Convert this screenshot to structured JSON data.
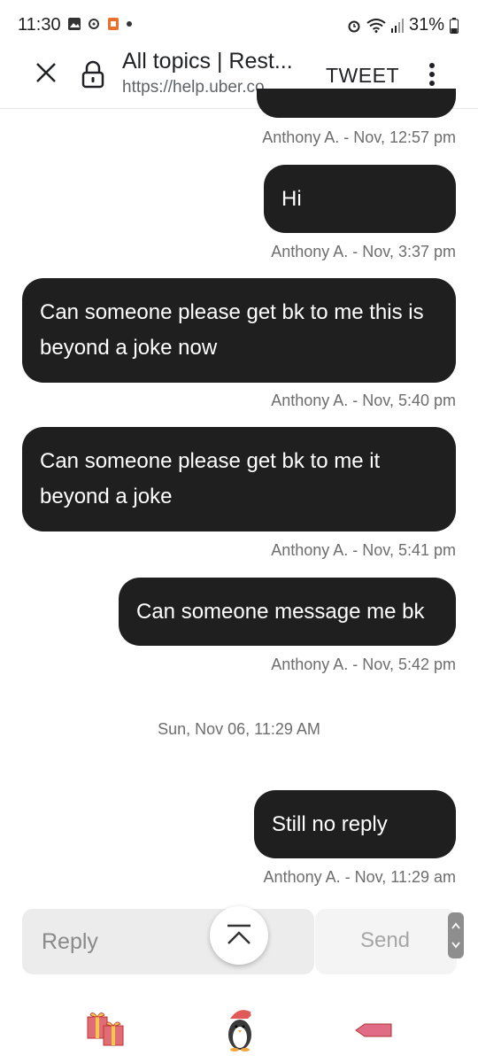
{
  "status_bar": {
    "time": "11:30",
    "battery": "31%"
  },
  "toolbar": {
    "title": "All topics | Rest...",
    "url": "https://help.uber.co...",
    "tweet_label": "TWEET",
    "close_icon": "close-icon",
    "lock_icon": "lock-icon",
    "more_icon": "more-vert-icon"
  },
  "messages": [
    {
      "text": "",
      "meta": "Anthony A. - Nov, 12:57 pm"
    },
    {
      "text": "Hi",
      "meta": "Anthony A. - Nov, 3:37 pm"
    },
    {
      "text": "Can someone please get bk to me this is beyond a joke now",
      "meta": "Anthony A. - Nov, 5:40 pm"
    },
    {
      "text": "Can someone please get bk to me it beyond a joke",
      "meta": "Anthony A. - Nov, 5:41 pm"
    },
    {
      "text": "Can someone message me bk",
      "meta": "Anthony A. - Nov, 5:42 pm"
    },
    {
      "text": "Still no reply",
      "meta": "Anthony A. - Nov, 11:29 am"
    }
  ],
  "date_separator": "Sun, Nov 06, 11:29 AM",
  "reply_bar": {
    "placeholder": "Reply",
    "send_label": "Send"
  },
  "colors": {
    "bubble": "#1f1f1f",
    "meta_text": "#6d6d6d"
  }
}
